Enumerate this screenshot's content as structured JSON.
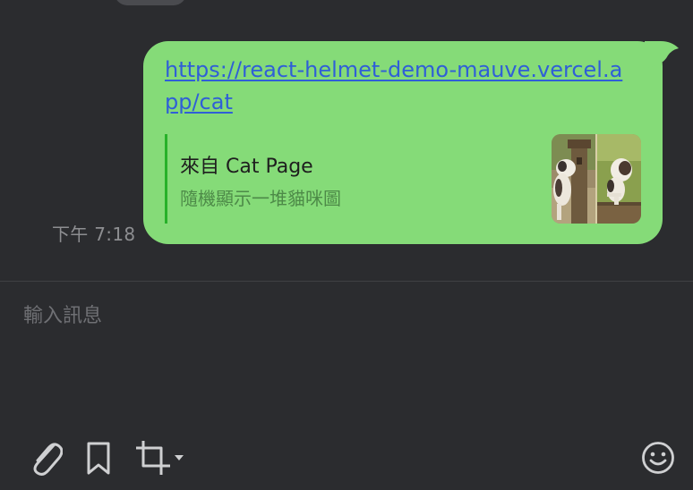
{
  "message": {
    "time": "下午 7:18",
    "link_text": "https://react-helmet-demo-mauve.vercel.app/cat",
    "preview": {
      "title": "來自 Cat Page",
      "description": "隨機顯示一堆貓咪圖"
    }
  },
  "composer": {
    "placeholder": "輸入訊息"
  },
  "toolbar": {
    "icons": [
      "paperclip-icon",
      "bookmark-icon",
      "crop-icon",
      "dropdown-arrow-icon",
      "smiley-icon"
    ]
  },
  "colors": {
    "background": "#2b2c2f",
    "bubble": "#85db78",
    "link": "#2f5fd7",
    "preview_bar": "#27b12a",
    "muted_text": "#8d8e91",
    "icon": "#cfd0d2"
  }
}
